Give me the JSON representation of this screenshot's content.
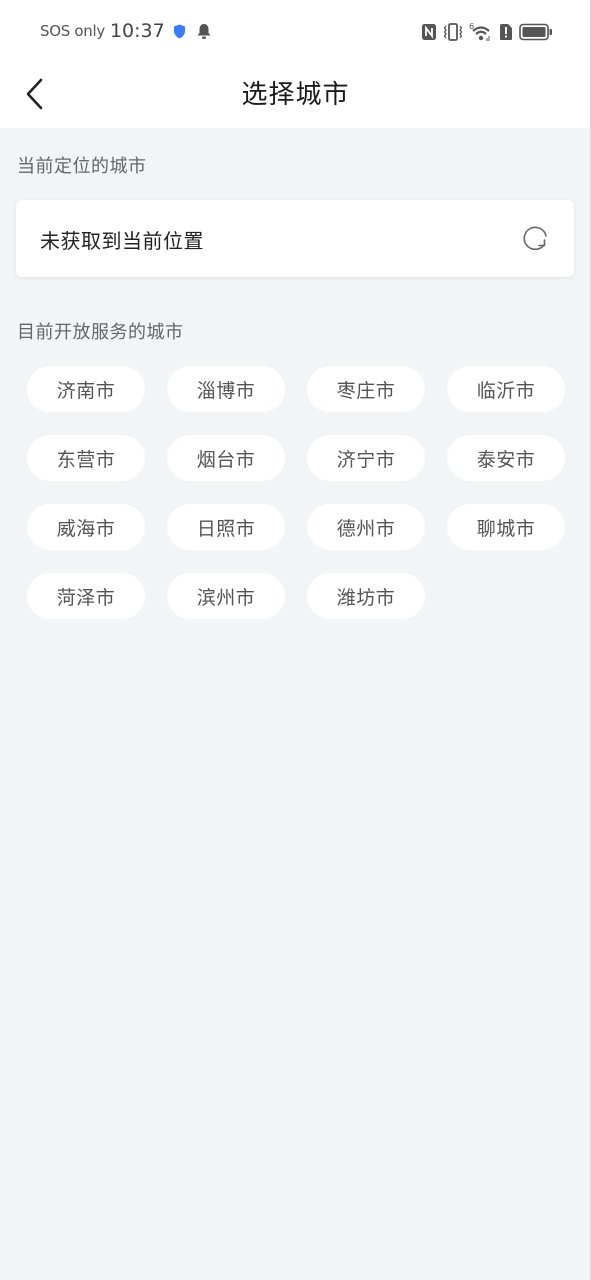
{
  "status_bar": {
    "carrier": "SOS only",
    "time": "10:37",
    "icons_left": [
      "shield-icon",
      "bell-icon"
    ],
    "icons_right": [
      "nfc-icon",
      "vibrate-icon",
      "wifi-icon",
      "alert-sim-icon",
      "battery-icon"
    ],
    "wifi_badge": "6",
    "shield_color": "#3b7cf5"
  },
  "header": {
    "back_icon": "chevron-left-icon",
    "title": "选择城市"
  },
  "current_location": {
    "label": "当前定位的城市",
    "status_text": "未获取到当前位置",
    "refresh_icon": "refresh-icon"
  },
  "service_cities": {
    "label": "目前开放服务的城市",
    "cities": [
      "济南市",
      "淄博市",
      "枣庄市",
      "临沂市",
      "东营市",
      "烟台市",
      "济宁市",
      "泰安市",
      "威海市",
      "日照市",
      "德州市",
      "聊城市",
      "菏泽市",
      "滨州市",
      "潍坊市"
    ]
  },
  "colors": {
    "background": "#f3f4f6",
    "card": "#ffffff",
    "title_text": "#1a1a1a",
    "secondary_text": "#666666"
  }
}
